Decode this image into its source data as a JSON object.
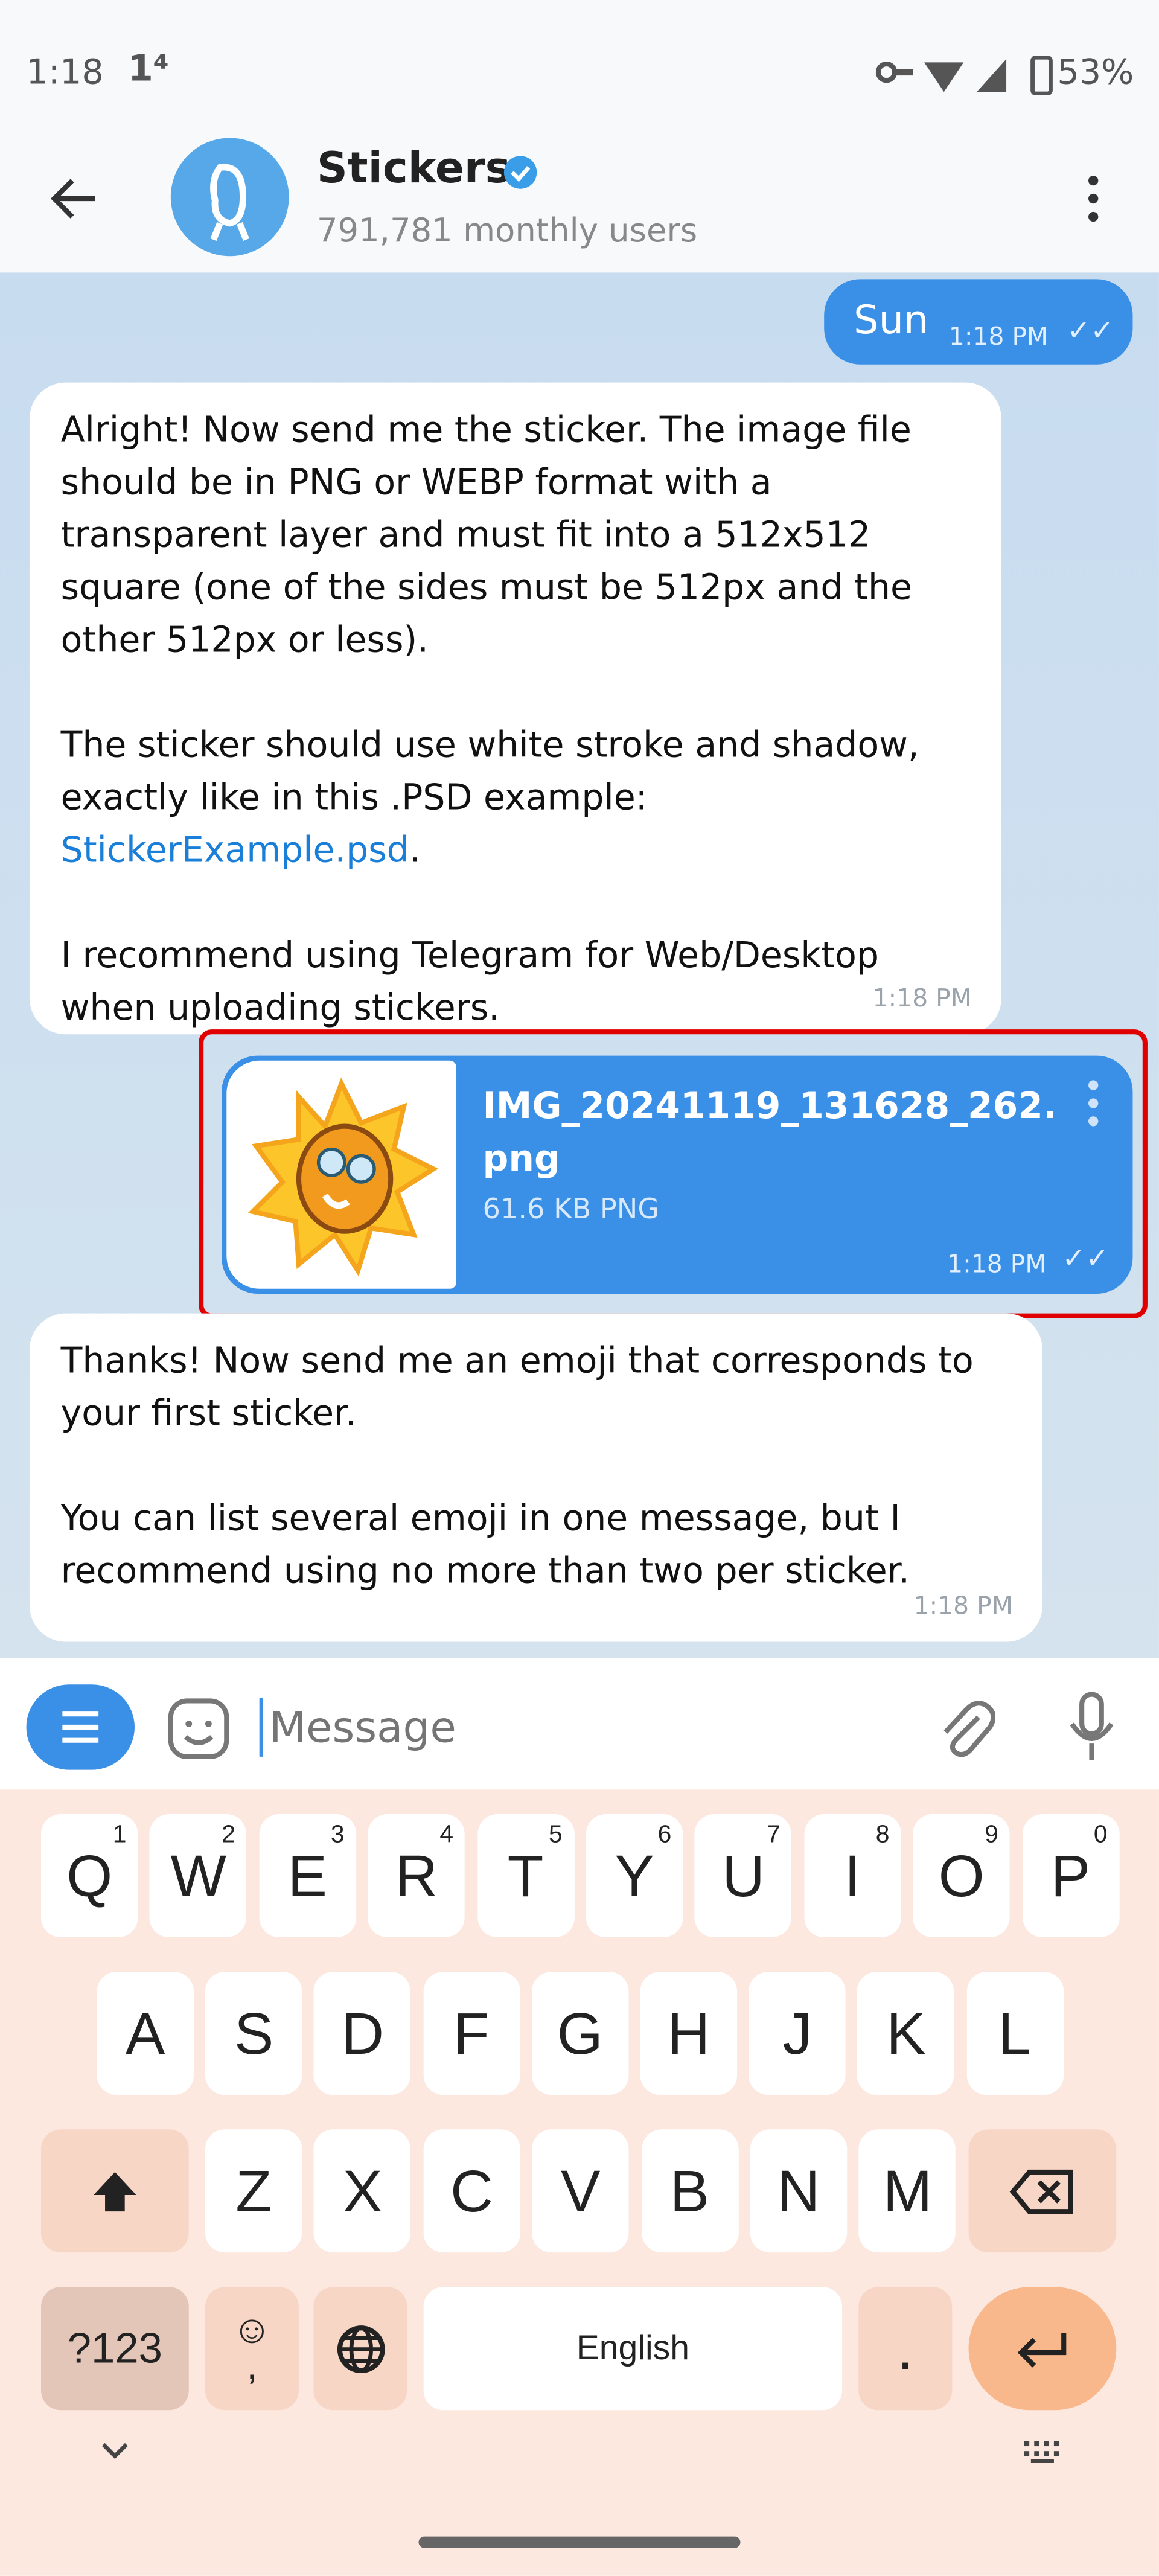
{
  "status_bar": {
    "time": "1:18",
    "notification": "1⁴",
    "battery": "53%",
    "icons": [
      "vpn-key-icon",
      "wifi-icon",
      "signal-icon",
      "battery-charging-icon"
    ]
  },
  "header": {
    "title": "Stickers",
    "subtitle": "791,781 monthly users",
    "verified": true
  },
  "messages": [
    {
      "dir": "out",
      "text": "Sun",
      "time": "1:18 PM",
      "status": "read"
    },
    {
      "dir": "in",
      "paragraphs": [
        "Alright! Now send me the sticker. The image file should be in PNG or WEBP format with a transparent layer and must fit into a 512x512 square (one of the sides must be 512px and the other 512px or less).",
        "The sticker should use white stroke and shadow, exactly like in this .PSD example:",
        "I recommend using Telegram for Web/Desktop when uploading stickers."
      ],
      "link": "StickerExample.psd",
      "time": "1:18 PM"
    },
    {
      "dir": "out",
      "file_name": "IMG_20241119_131628_262.png",
      "file_info": "61.6 KB PNG",
      "time": "1:18 PM",
      "status": "read"
    },
    {
      "dir": "in",
      "paragraphs": [
        "Thanks! Now send me an emoji that corresponds to your first sticker.",
        "You can list several emoji in one message, but I recommend using no more than two per sticker."
      ],
      "time": "1:18 PM"
    }
  ],
  "input": {
    "placeholder": "Message"
  },
  "keyboard": {
    "row1": [
      [
        "Q",
        "1"
      ],
      [
        "W",
        "2"
      ],
      [
        "E",
        "3"
      ],
      [
        "R",
        "4"
      ],
      [
        "T",
        "5"
      ],
      [
        "Y",
        "6"
      ],
      [
        "U",
        "7"
      ],
      [
        "I",
        "8"
      ],
      [
        "O",
        "9"
      ],
      [
        "P",
        "0"
      ]
    ],
    "row2": [
      "A",
      "S",
      "D",
      "F",
      "G",
      "H",
      "J",
      "K",
      "L"
    ],
    "row3": [
      "Z",
      "X",
      "C",
      "V",
      "B",
      "N",
      "M"
    ],
    "symbols": "?123",
    "space": "English",
    "period": ".",
    "comma": ","
  },
  "colors": {
    "accent": "#3a8fe6",
    "highlight": "#e00000",
    "keyboard_bg": "#fce8df"
  }
}
